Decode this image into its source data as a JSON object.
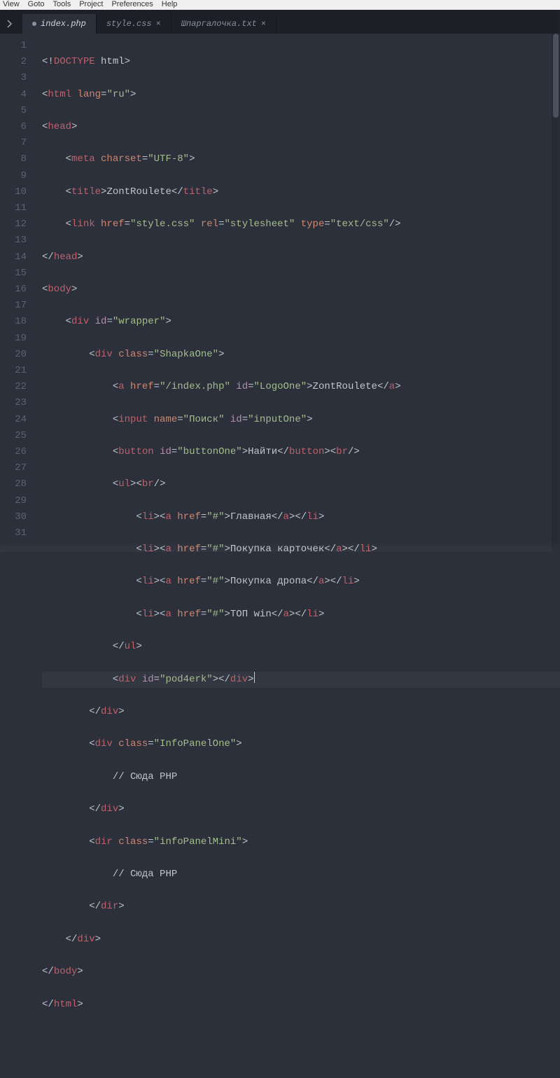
{
  "menu": {
    "view": "View",
    "goto": "Goto",
    "tools": "Tools",
    "project": "Project",
    "preferences": "Preferences",
    "help": "Help"
  },
  "tabs": [
    {
      "label": "index.php",
      "active": true,
      "modified": true
    },
    {
      "label": "style.css",
      "active": false,
      "modified": false
    },
    {
      "label": "Шпаргалочка.txt",
      "active": false,
      "modified": false
    }
  ],
  "icon": {
    "sidebar_toggle": "sidebar-toggle-icon"
  },
  "code": {
    "line_start": 1,
    "line_end": 31,
    "current_line": 20,
    "tokens": {
      "doctype_open": "<!",
      "doctype_kw": "DOCTYPE",
      "doctype_rest": " html",
      "html": "html",
      "lang": "lang",
      "ru": "\"ru\"",
      "head": "head",
      "meta": "meta",
      "charset": "charset",
      "utf8": "\"UTF-8\"",
      "title": "title",
      "title_text": "ZontRoulete",
      "link": "link",
      "href": "href",
      "stylecss": "\"style.css\"",
      "rel": "rel",
      "stylesheet": "\"stylesheet\"",
      "type": "type",
      "textcss": "\"text/css\"",
      "body": "body",
      "div": "div",
      "id": "id",
      "class": "class",
      "wrapper": "\"wrapper\"",
      "shapka": "\"ShapkaOne\"",
      "a": "a",
      "indexphp": "\"/index.php\"",
      "logoone": "\"LogoOne\"",
      "logo_text": "ZontRoulete",
      "input": "input",
      "name": "name",
      "poisk": "\"Поиск\"",
      "inputone": "\"inputOne\"",
      "button": "button",
      "buttonone": "\"buttonOne\"",
      "find": "Найти",
      "br": "br",
      "ul": "ul",
      "li": "li",
      "hash": "\"#\"",
      "nav1": "Главная",
      "nav2": "Покупка карточек",
      "nav3": "Покупка дропа",
      "nav4": "ТОП win",
      "pod4erk": "\"pod4erk\"",
      "infopanelone": "\"InfoPanelOne\"",
      "comment": "// Сюда PHP",
      "dir": "dir",
      "infopanelmini": "\"infoPanelMini\""
    }
  }
}
